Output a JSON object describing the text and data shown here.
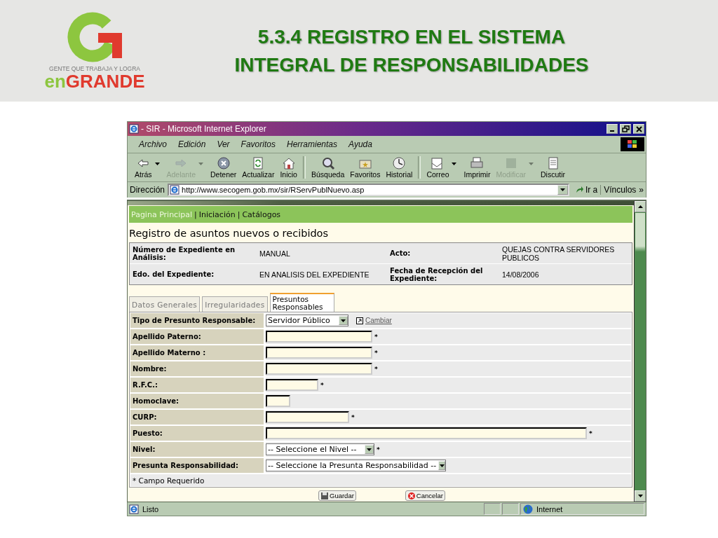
{
  "slide": {
    "title_line_1": "5.3.4 REGISTRO EN EL SISTEMA",
    "title_line_2": "INTEGRAL DE RESPONSABILIDADES",
    "logo": {
      "tagline": "GENTE QUE TRABAJA Y LOGRA",
      "word_part_1": "en",
      "word_part_2": "GRANDE"
    }
  },
  "window": {
    "title": "- SIR - Microsoft Internet Explorer"
  },
  "menu": [
    "Archivo",
    "Edición",
    "Ver",
    "Favoritos",
    "Herramientas",
    "Ayuda"
  ],
  "toolbar": [
    {
      "label": "Atrás",
      "disabled": false,
      "dropdown": true
    },
    {
      "label": "Adelante",
      "disabled": true,
      "dropdown": true
    },
    {
      "label": "Detener",
      "disabled": false,
      "dropdown": false
    },
    {
      "label": "Actualizar",
      "disabled": false,
      "dropdown": false
    },
    {
      "label": "Inicio",
      "disabled": false,
      "dropdown": false
    },
    {
      "label": "Búsqueda",
      "disabled": false,
      "dropdown": false
    },
    {
      "label": "Favoritos",
      "disabled": false,
      "dropdown": false
    },
    {
      "label": "Historial",
      "disabled": false,
      "dropdown": false
    },
    {
      "label": "Correo",
      "disabled": false,
      "dropdown": true
    },
    {
      "label": "Imprimir",
      "disabled": false,
      "dropdown": false
    },
    {
      "label": "Modificar",
      "disabled": true,
      "dropdown": true
    },
    {
      "label": "Discutir",
      "disabled": false,
      "dropdown": false
    }
  ],
  "address_bar": {
    "label": "Dirección",
    "value": "http://www.secogem.gob.mx/sir/RServPublNuevo.asp",
    "go": "Ir a",
    "links_label": "Vínculos",
    "links_more": "»"
  },
  "nav": {
    "separator": "|",
    "links": [
      {
        "label": "Pagina Principal",
        "current": true
      },
      {
        "label": "Iniciación",
        "current": false
      },
      {
        "label": "Catálogos",
        "current": false
      }
    ]
  },
  "page_title": "Registro de asuntos nuevos o recibidos",
  "info": [
    {
      "label": "Número de Expediente en Análisis:",
      "value": "MANUAL"
    },
    {
      "label": "Acto:",
      "value": "QUEJAS CONTRA SERVIDORES PUBLICOS"
    },
    {
      "label": "Edo. del Expediente:",
      "value": "EN ANALISIS DEL EXPEDIENTE"
    },
    {
      "label": "Fecha de Recepción del Expediente:",
      "value": "14/08/2006"
    }
  ],
  "tabs": [
    {
      "label": "Datos Generales",
      "selected": false
    },
    {
      "label": "Irregularidades",
      "selected": false
    },
    {
      "label": "Presuntos Responsables",
      "selected": true
    }
  ],
  "form": {
    "rows": [
      {
        "label": "Tipo de Presunto Responsable:",
        "kind": "select",
        "value": "Servidor Público",
        "action": "Cambiar"
      },
      {
        "label": "Apellido Paterno:",
        "kind": "text",
        "marker": "*"
      },
      {
        "label": "Apellido Materno :",
        "kind": "text",
        "marker": "*"
      },
      {
        "label": "Nombre:",
        "kind": "text",
        "marker": "*"
      },
      {
        "label": "R.F.C.:",
        "kind": "text",
        "marker": "*"
      },
      {
        "label": "Homoclave:",
        "kind": "text"
      },
      {
        "label": "CURP:",
        "kind": "text",
        "marker": "*"
      },
      {
        "label": "Puesto:",
        "kind": "text",
        "marker": "*"
      },
      {
        "label": "Nivel:",
        "kind": "select",
        "value": "-- Seleccione el Nivel --",
        "marker": "*"
      },
      {
        "label": "Presunta Responsabilidad:",
        "kind": "select",
        "value": "-- Seleccione la Presunta Responsabilidad --"
      }
    ],
    "note": "* Campo Requerido"
  },
  "buttons": [
    "Guardar",
    "Cancelar"
  ],
  "status": {
    "text": "Listo",
    "zone": "Internet"
  }
}
